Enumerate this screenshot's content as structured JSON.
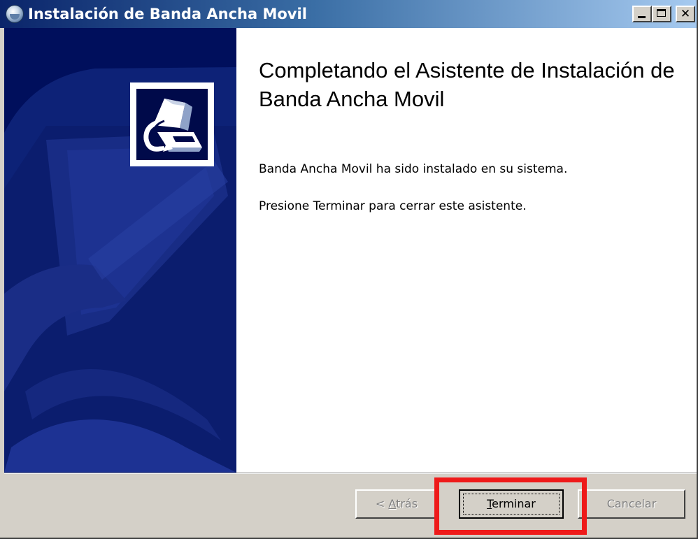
{
  "window": {
    "title": "Instalación de Banda Ancha Movil",
    "icon": "installer-globe-icon",
    "controls": {
      "minimize": "_",
      "maximize": "□",
      "close": "✕"
    }
  },
  "side_panel": {
    "logo_icon": "computer-setup-icon"
  },
  "content": {
    "heading": "Completando el Asistente de Instalación de Banda Ancha Movil",
    "message_1": "Banda Ancha Movil ha sido instalado en su sistema.",
    "message_2": "Presione Terminar para cerrar este asistente."
  },
  "buttons": {
    "back": {
      "prefix": "< ",
      "mnemonic": "A",
      "rest": "trás",
      "enabled": false
    },
    "finish": {
      "mnemonic": "T",
      "rest": "erminar",
      "enabled": true,
      "focused": true
    },
    "cancel": {
      "label": "Cancelar",
      "enabled": false
    }
  },
  "colors": {
    "titlebar_start": "#0a246a",
    "titlebar_end": "#a6caf0",
    "side_panel": "#000f5c",
    "highlight": "#ee1a1a"
  }
}
